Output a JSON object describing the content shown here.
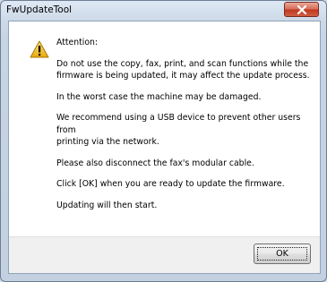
{
  "window": {
    "title": "FwUpdateTool"
  },
  "icons": {
    "close": "close-x",
    "warning": "warning-triangle"
  },
  "colors": {
    "close_button": "#c2391f",
    "warning_fill": "#f2c12e",
    "footer": "#f0f0f0"
  },
  "message": {
    "heading": "Attention:",
    "p1_line1": "Do not use the copy, fax, print, and scan functions while the",
    "p1_line2": "firmware is being updated, it may affect the update process.",
    "p2": "In the worst case the machine may be damaged.",
    "p3_line1": "We recommend using a USB device to prevent other users from",
    "p3_line2": "printing via the network.",
    "p4": "Please also disconnect the fax's modular cable.",
    "p5": "Click [OK] when you are ready to update the firmware.",
    "p6": "Updating will then start."
  },
  "buttons": {
    "ok": "OK"
  }
}
